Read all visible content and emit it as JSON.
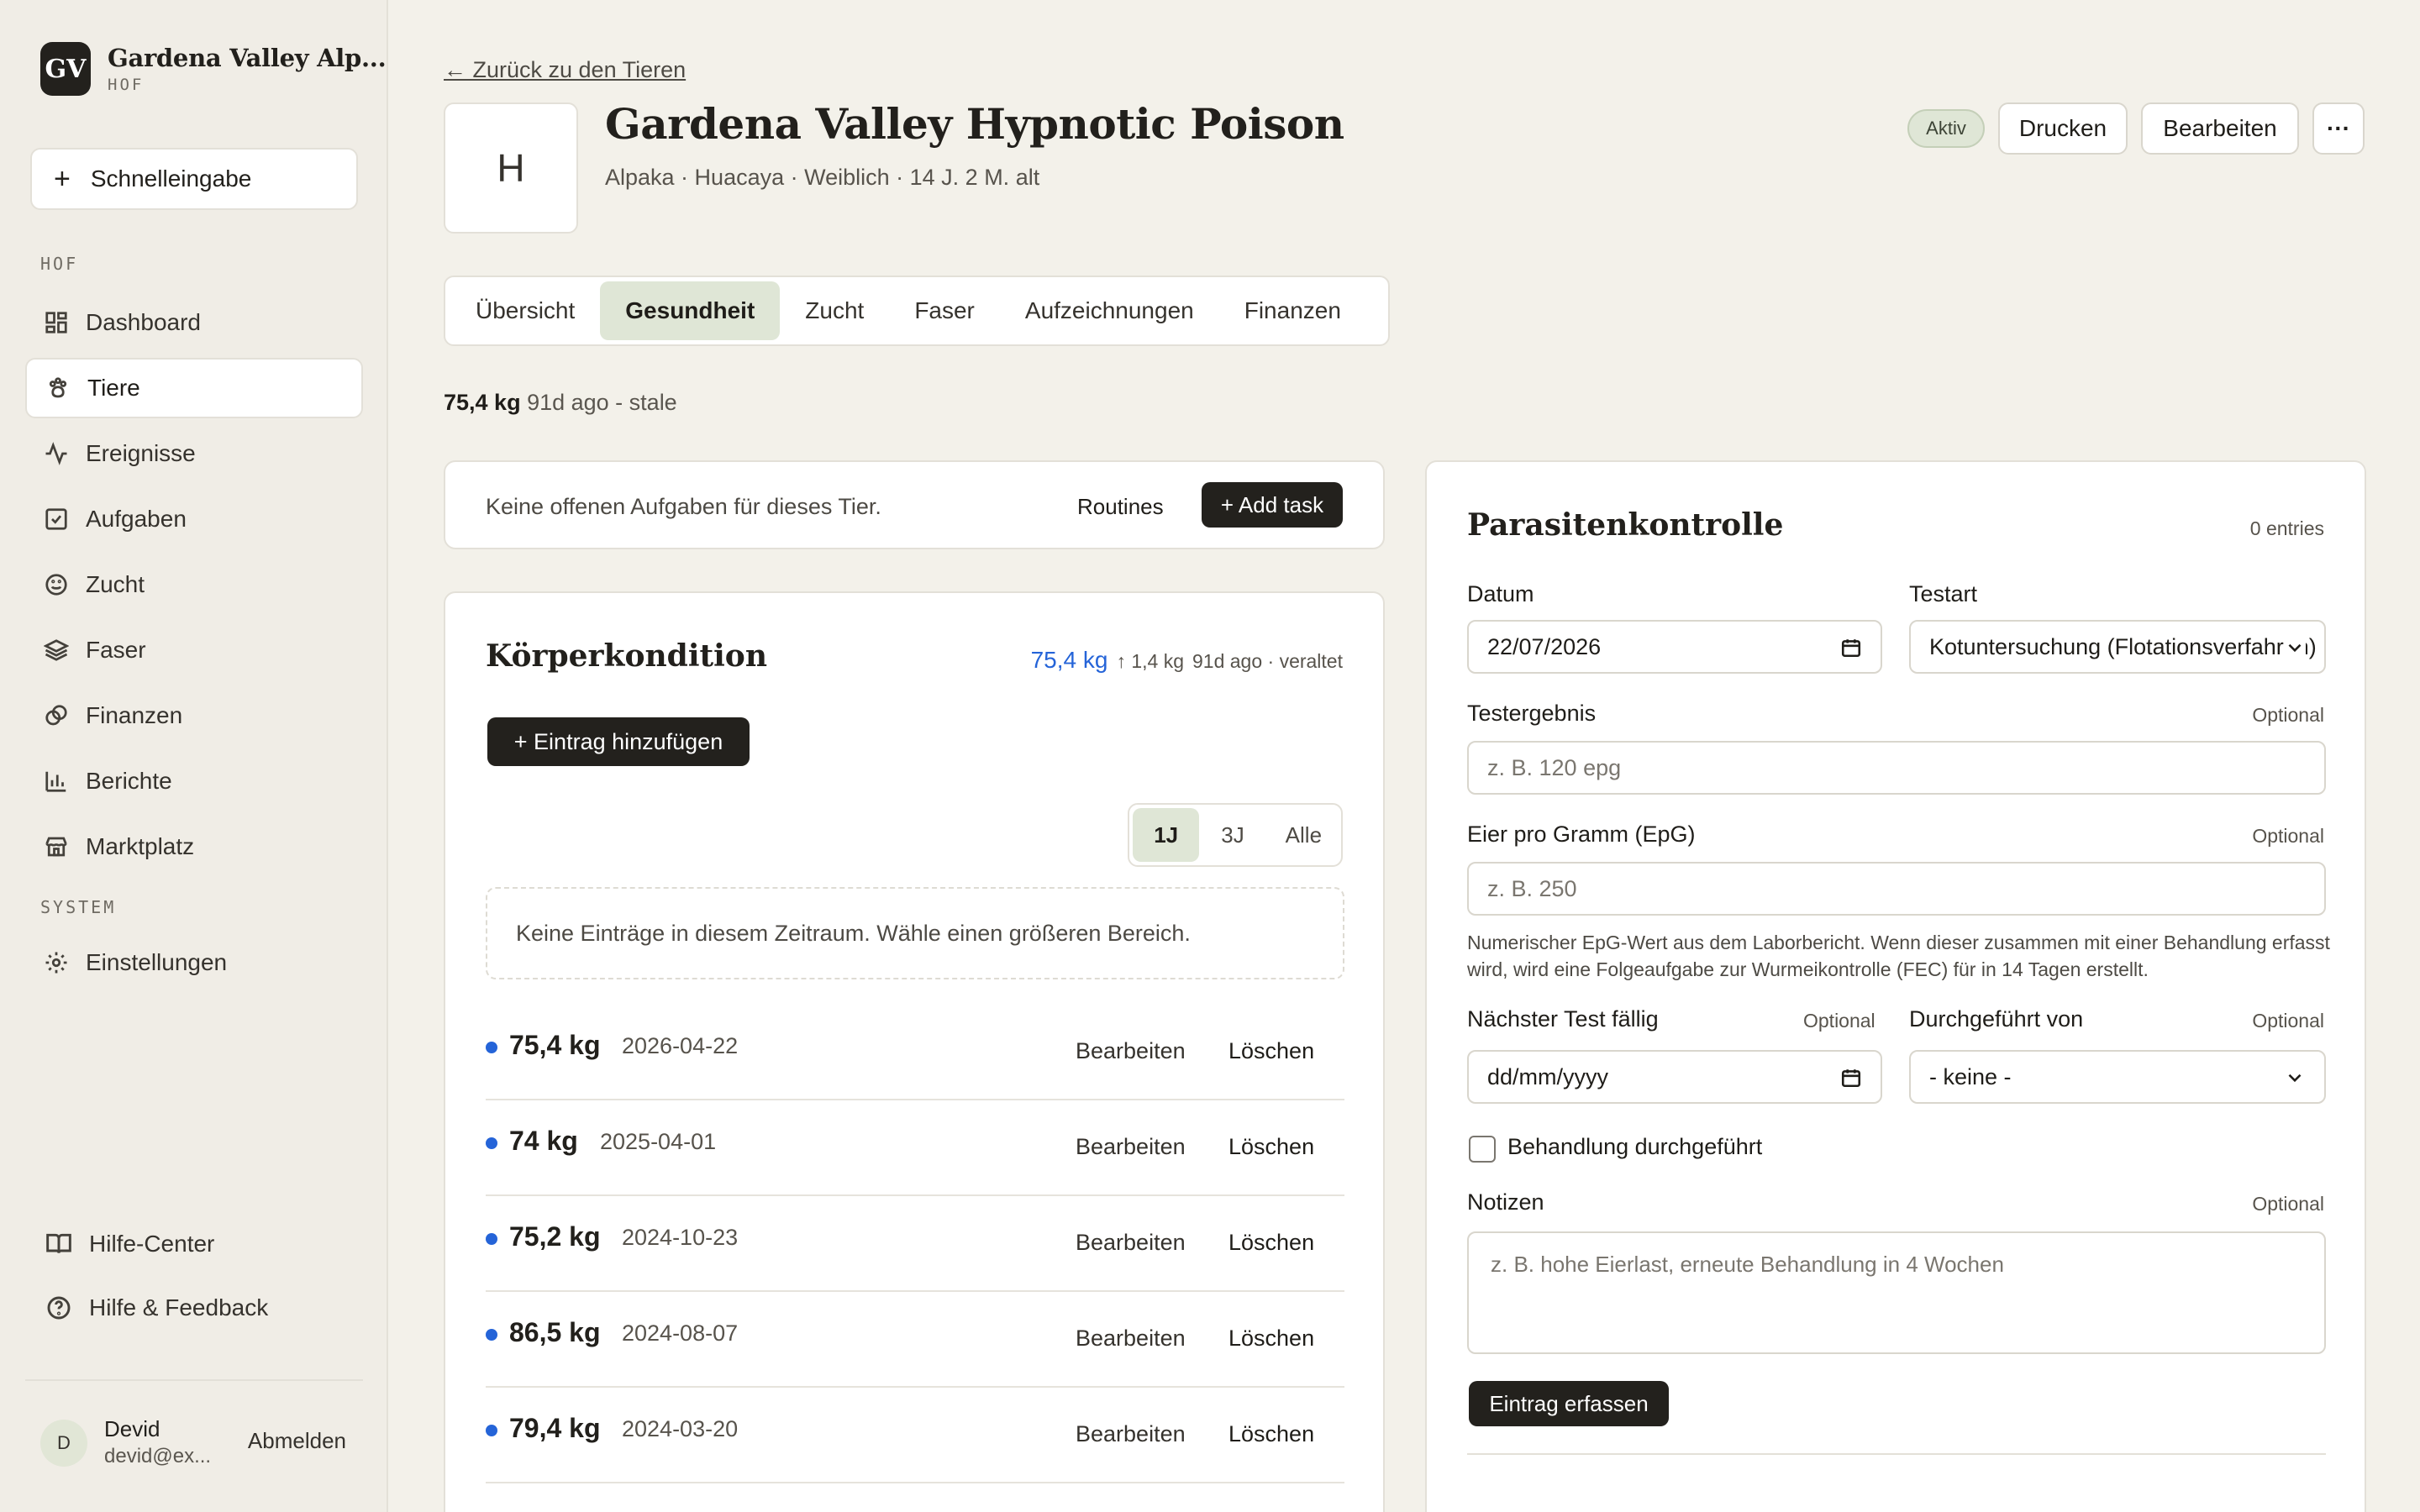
{
  "brand": {
    "logo": "GV",
    "name": "Gardena Valley Alp...",
    "sub": "HOF"
  },
  "quick_add": {
    "label": "Schnelleingabe",
    "icon": "plus-icon"
  },
  "nav": {
    "section_farm": "HOF",
    "section_system": "SYSTEM",
    "items": [
      {
        "label": "Dashboard",
        "icon": "grid-icon"
      },
      {
        "label": "Tiere",
        "icon": "paw-icon"
      },
      {
        "label": "Ereignisse",
        "icon": "activity-icon"
      },
      {
        "label": "Aufgaben",
        "icon": "checkbox-icon"
      },
      {
        "label": "Zucht",
        "icon": "smile-icon"
      },
      {
        "label": "Faser",
        "icon": "layers-icon"
      },
      {
        "label": "Finanzen",
        "icon": "coins-icon"
      },
      {
        "label": "Berichte",
        "icon": "bar-chart-icon"
      },
      {
        "label": "Marktplatz",
        "icon": "store-icon"
      }
    ],
    "settings": {
      "label": "Einstellungen",
      "icon": "gear-icon"
    },
    "active": "Tiere"
  },
  "help": {
    "center": "Hilfe-Center",
    "feedback": "Hilfe & Feedback"
  },
  "user": {
    "initial": "D",
    "name": "Devid",
    "email": "devid@ex...",
    "logout": "Abmelden"
  },
  "header": {
    "back": "← Zurück zu den Tieren",
    "avatar_letter": "H",
    "title": "Gardena Valley Hypnotic Poison",
    "subtitle": "Alpaka · Huacaya · Weiblich · 14 J. 2 M. alt",
    "status": "Aktiv",
    "print": "Drucken",
    "edit": "Bearbeiten",
    "more": "···"
  },
  "tabs": [
    "Übersicht",
    "Gesundheit",
    "Zucht",
    "Faser",
    "Aufzeichnungen",
    "Finanzen"
  ],
  "active_tab": "Gesundheit",
  "weight_summary": {
    "weight": "75,4 kg",
    "meta": "91d ago - stale"
  },
  "tasks": {
    "empty": "Keine offenen Aufgaben für dieses Tier.",
    "routines": "Routines",
    "add": "+ Add task"
  },
  "body_condition": {
    "title": "Körperkondition",
    "current": "75,4 kg",
    "delta": "↑ 1,4 kg",
    "age": "91d ago · veraltet",
    "add": "+ Eintrag hinzufügen",
    "ranges": [
      "1J",
      "3J",
      "Alle"
    ],
    "active_range": "1J",
    "empty": "Keine Einträge in diesem Zeitraum. Wähle einen größeren Bereich.",
    "edit_label": "Bearbeiten",
    "delete_label": "Löschen",
    "entries": [
      {
        "weight": "75,4 kg",
        "date": "2026-04-22"
      },
      {
        "weight": "74 kg",
        "date": "2025-04-01"
      },
      {
        "weight": "75,2 kg",
        "date": "2024-10-23"
      },
      {
        "weight": "86,5 kg",
        "date": "2024-08-07"
      },
      {
        "weight": "79,4 kg",
        "date": "2024-03-20"
      }
    ],
    "accent": "#2564d8"
  },
  "parasite": {
    "title": "Parasitenkontrolle",
    "count": "0 entries",
    "date_label": "Datum",
    "date_value": "22/07/2026",
    "test_type_label": "Testart",
    "test_type_value": "Kotuntersuchung (Flotationsverfahren)",
    "result_label": "Testergebnis",
    "result_placeholder": "z. B. 120 epg",
    "epg_label": "Eier pro Gramm (EpG)",
    "epg_placeholder": "z. B. 250",
    "optional": "Optional",
    "hint": "Numerischer EpG-Wert aus dem Laborbericht. Wenn dieser zusammen mit einer Behandlung erfasst wird, wird eine Folgeaufgabe zur Wurmeikontrolle (FEC) für in 14 Tagen erstellt.",
    "next_label": "Nächster Test fällig",
    "next_placeholder": "dd/mm/yyyy",
    "by_label": "Durchgeführt von",
    "by_value": "- keine -",
    "treated_label": "Behandlung durchgeführt",
    "notes_label": "Notizen",
    "notes_placeholder": "z. B. hohe Eierlast, erneute Behandlung in 4 Wochen",
    "submit": "Eintrag erfassen"
  }
}
